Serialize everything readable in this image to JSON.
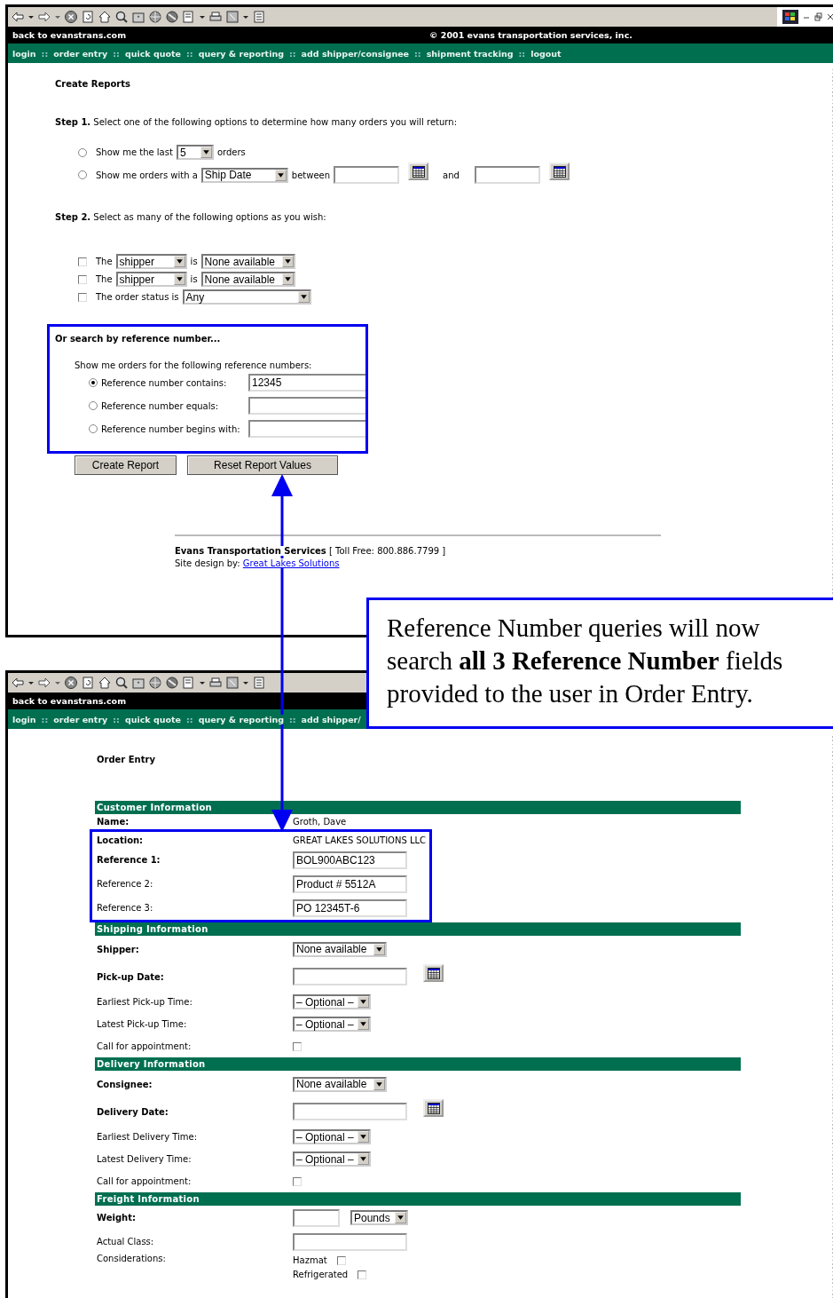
{
  "report_window": {
    "top_bar": {
      "back_link": "back to evanstrans.com",
      "copyright": "© 2001 evans transportation services, inc."
    },
    "nav": [
      {
        "kind": "link",
        "label": "login"
      },
      {
        "kind": "separator",
        "label": "::"
      },
      {
        "kind": "link",
        "label": "order entry"
      },
      {
        "kind": "separator",
        "label": "::"
      },
      {
        "kind": "link",
        "label": "quick quote"
      },
      {
        "kind": "separator",
        "label": "::"
      },
      {
        "kind": "link",
        "label": "query & reporting"
      },
      {
        "kind": "separator",
        "label": "::"
      },
      {
        "kind": "link",
        "label": "add shipper/consignee"
      },
      {
        "kind": "separator",
        "label": "::"
      },
      {
        "kind": "link",
        "label": "shipment tracking"
      },
      {
        "kind": "separator",
        "label": "::"
      },
      {
        "kind": "link",
        "label": "logout"
      }
    ],
    "page_title": "Create Reports",
    "step1": {
      "heading": "Step 1.",
      "text": "Select one of the following options to determine how many orders you will return:",
      "options": [
        {
          "kind": "last",
          "selected": false,
          "prefix": "Show me the last",
          "select": "5",
          "suffix": "orders"
        },
        {
          "kind": "range",
          "selected": false,
          "prefix": "Show me orders with a",
          "select": "Ship Date",
          "between": "between",
          "and": "and"
        }
      ]
    },
    "step2": {
      "heading": "Step 2.",
      "text": "Select as many of the following options as you wish:",
      "filters": [
        {
          "kind": "pair",
          "checked": false,
          "label": "The",
          "field": "shipper",
          "is": "is",
          "value": "None available"
        },
        {
          "kind": "pair",
          "checked": false,
          "label": "The",
          "field": "shipper",
          "is": "is",
          "value": "None available"
        },
        {
          "kind": "status",
          "checked": false,
          "label": "The order status is",
          "value": "Any"
        }
      ]
    },
    "reference_search": {
      "title": "Or search by reference number...",
      "intro": "Show me orders for the following reference numbers:",
      "options": [
        {
          "label": "Reference number contains:",
          "selected": true,
          "value": "12345"
        },
        {
          "label": "Reference number equals:",
          "selected": false
        },
        {
          "label": "Reference number begins with:",
          "selected": false
        }
      ]
    },
    "buttons": [
      "Create Report",
      "Reset Report Values"
    ],
    "footer": {
      "company": "Evans Transportation Services",
      "toll_free": "[ Toll Free: 800.886.7799 ]",
      "credit": "Site design by:",
      "credit_link": "Great Lakes Solutions"
    }
  },
  "order_window": {
    "top_bar": {
      "back_link": "back to evanstrans.com"
    },
    "nav": [
      {
        "kind": "link",
        "label": "login"
      },
      {
        "kind": "separator",
        "label": "::"
      },
      {
        "kind": "link",
        "label": "order entry"
      },
      {
        "kind": "separator",
        "label": "::"
      },
      {
        "kind": "link",
        "label": "quick quote"
      },
      {
        "kind": "separator",
        "label": "::"
      },
      {
        "kind": "link",
        "label": "query & reporting"
      },
      {
        "kind": "separator",
        "label": "::"
      },
      {
        "kind": "link",
        "label": "add shipper/"
      }
    ],
    "page_title": "Order Entry",
    "sections": [
      {
        "title": "Customer Information",
        "rows": [
          {
            "kind": "text",
            "bold": true,
            "label": "Name:",
            "value": "Groth, Dave"
          }
        ],
        "highlighted_rows": [
          {
            "kind": "text",
            "bold": true,
            "label": "Location:",
            "value": "GREAT LAKES SOLUTIONS LLC"
          },
          {
            "kind": "input",
            "bold": true,
            "label": "Reference 1:",
            "value": "BOL900ABC123"
          },
          {
            "kind": "input",
            "bold": false,
            "label": "Reference 2:",
            "value": "Product # 5512A"
          },
          {
            "kind": "input",
            "bold": false,
            "label": "Reference 3:",
            "value": "PO 12345T-6"
          }
        ]
      },
      {
        "title": "Shipping Information",
        "rows": [
          {
            "kind": "select",
            "bold": true,
            "label": "Shipper:",
            "value": "None available"
          },
          {
            "kind": "date",
            "bold": true,
            "label": "Pick-up Date:"
          },
          {
            "kind": "time",
            "bold": false,
            "label": "Earliest Pick-up Time:",
            "value": "– Optional –"
          },
          {
            "kind": "time",
            "bold": false,
            "label": "Latest Pick-up Time:",
            "value": "– Optional –"
          },
          {
            "kind": "checkbox",
            "bold": false,
            "label": "Call for appointment:",
            "checked": false
          }
        ]
      },
      {
        "title": "Delivery Information",
        "rows": [
          {
            "kind": "select",
            "bold": true,
            "label": "Consignee:",
            "value": "None available"
          },
          {
            "kind": "date",
            "bold": true,
            "label": "Delivery Date:"
          },
          {
            "kind": "time",
            "bold": false,
            "label": "Earliest Delivery Time:",
            "value": "– Optional –"
          },
          {
            "kind": "time",
            "bold": false,
            "label": "Latest Delivery Time:",
            "value": "– Optional –"
          },
          {
            "kind": "checkbox",
            "bold": false,
            "label": "Call for appointment:",
            "checked": false
          }
        ]
      },
      {
        "title": "Freight Information",
        "rows": [
          {
            "kind": "weight",
            "bold": true,
            "label": "Weight:",
            "unit": "Pounds"
          },
          {
            "kind": "input",
            "bold": false,
            "label": "Actual Class:"
          },
          {
            "kind": "checks",
            "bold": false,
            "label": "Considerations:",
            "items": [
              {
                "label": "Hazmat",
                "checked": false
              },
              {
                "label": "Refrigerated",
                "checked": false
              }
            ]
          }
        ]
      }
    ]
  },
  "callout": {
    "text": "Reference Number queries will now search **all 3 Reference Number** fields provided to the user in Order Entry."
  }
}
